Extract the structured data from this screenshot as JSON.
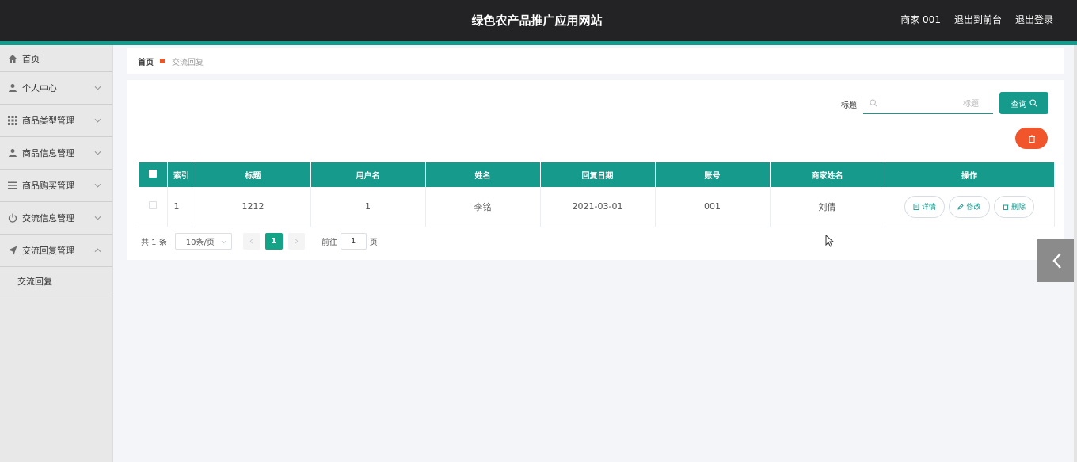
{
  "header": {
    "site_title": "绿色农产品推广应用网站",
    "user_label": "商家 001",
    "to_front_label": "退出到前台",
    "logout_label": "退出登录",
    "accent_color": "#169a8c"
  },
  "sidebar": {
    "items": [
      {
        "label": "首页",
        "icon": "home-icon"
      },
      {
        "label": "个人中心",
        "icon": "user-icon"
      },
      {
        "label": "商品类型管理",
        "icon": "grid-icon"
      },
      {
        "label": "商品信息管理",
        "icon": "user-icon"
      },
      {
        "label": "商品购买管理",
        "icon": "list-icon"
      },
      {
        "label": "交流信息管理",
        "icon": "power-icon"
      },
      {
        "label": "交流回复管理",
        "icon": "send-icon"
      }
    ],
    "submenu": {
      "label": "交流回复"
    }
  },
  "breadcrumb": {
    "home": "首页",
    "current": "交流回复"
  },
  "search": {
    "label": "标题",
    "placeholder": "标题",
    "value": "",
    "query_label": "查询"
  },
  "table": {
    "columns": [
      "索引",
      "标题",
      "用户名",
      "姓名",
      "回复日期",
      "账号",
      "商家姓名",
      "操作"
    ],
    "rows": [
      {
        "index": "1",
        "title": "1212",
        "username": "1",
        "name": "李铭",
        "date": "2021-03-01",
        "account": "001",
        "merchant": "刘倩"
      }
    ],
    "actions": {
      "detail": "详情",
      "edit": "修改",
      "delete": "删除"
    }
  },
  "pagination": {
    "total": "共 1 条",
    "page_size": "10条/页",
    "current_page": "1",
    "goto_label": "前往",
    "goto_value": "1",
    "page_suffix": "页"
  },
  "colors": {
    "primary": "#169a8c",
    "danger": "#f0552b",
    "topbar": "#232224"
  }
}
